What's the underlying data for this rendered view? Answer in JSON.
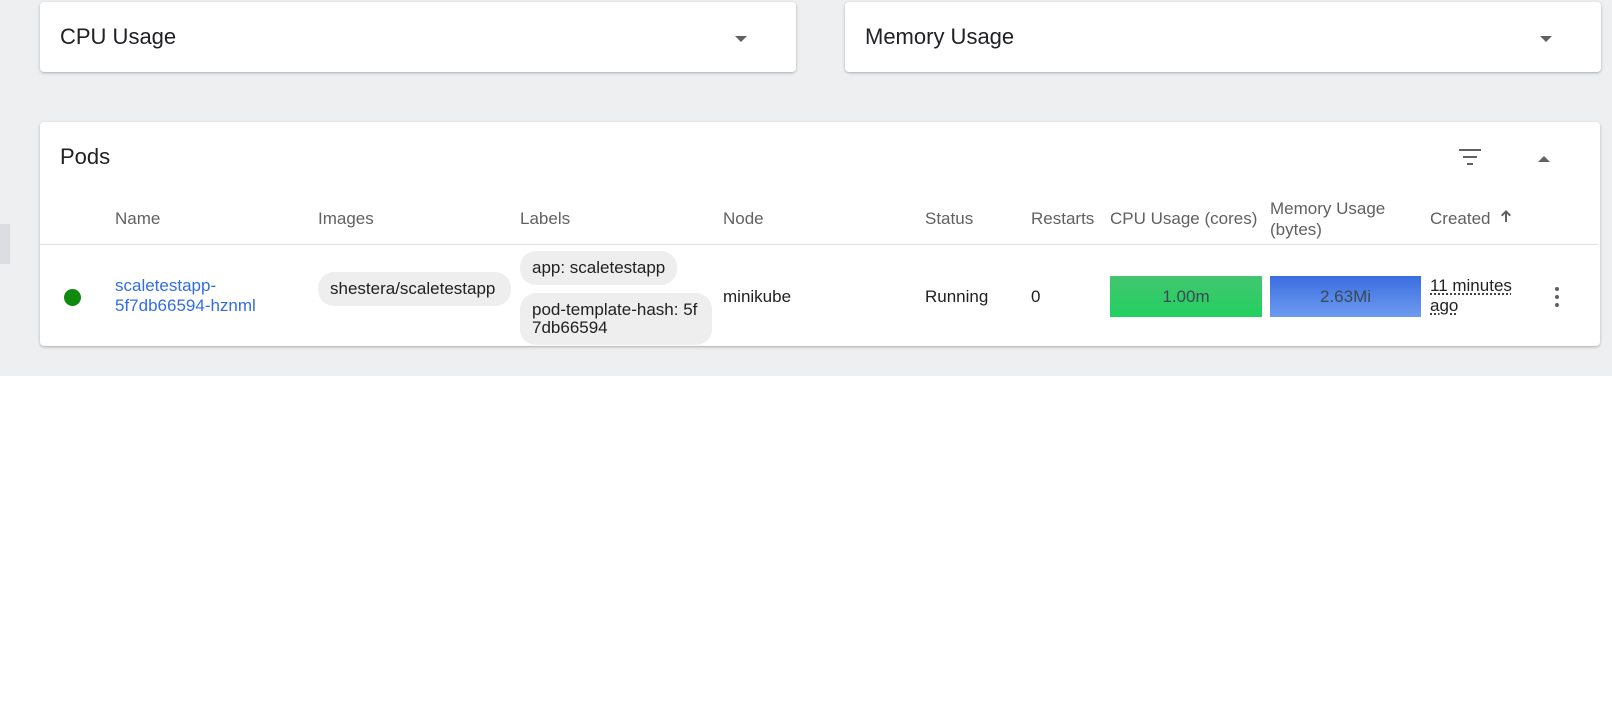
{
  "cpu_card": {
    "title": "CPU Usage"
  },
  "memory_card": {
    "title": "Memory Usage"
  },
  "pods_card": {
    "title": "Pods",
    "columns": {
      "name": "Name",
      "images": "Images",
      "labels": "Labels",
      "node": "Node",
      "status": "Status",
      "restarts": "Restarts",
      "cpu": "CPU Usage (cores)",
      "memory_line1": "Memory Usage",
      "memory_line2": "(bytes)",
      "created": "Created"
    },
    "rows": [
      {
        "name": "scaletestapp-5f7db66594-hznml",
        "image": "shestera/scaletestapp",
        "labels": [
          "app: scaletestapp",
          "pod-template-hash: 5f7db66594"
        ],
        "node": "minikube",
        "status": "Running",
        "restarts": "0",
        "cpu": "1.00m",
        "memory": "2.63Mi",
        "created": "11 minutes ago"
      }
    ]
  },
  "colors": {
    "background": "#eeeff0",
    "link": "#326de6",
    "status_running": "#0f8a0f",
    "cpu_bar": "#22d060",
    "memory_bar": "#3a6ee0"
  },
  "icons": {
    "dropdown": "chevron-down-icon",
    "filter": "filter-icon",
    "collapse": "chevron-up-icon",
    "sort": "arrow-up-icon",
    "menu": "more-vert-icon"
  }
}
